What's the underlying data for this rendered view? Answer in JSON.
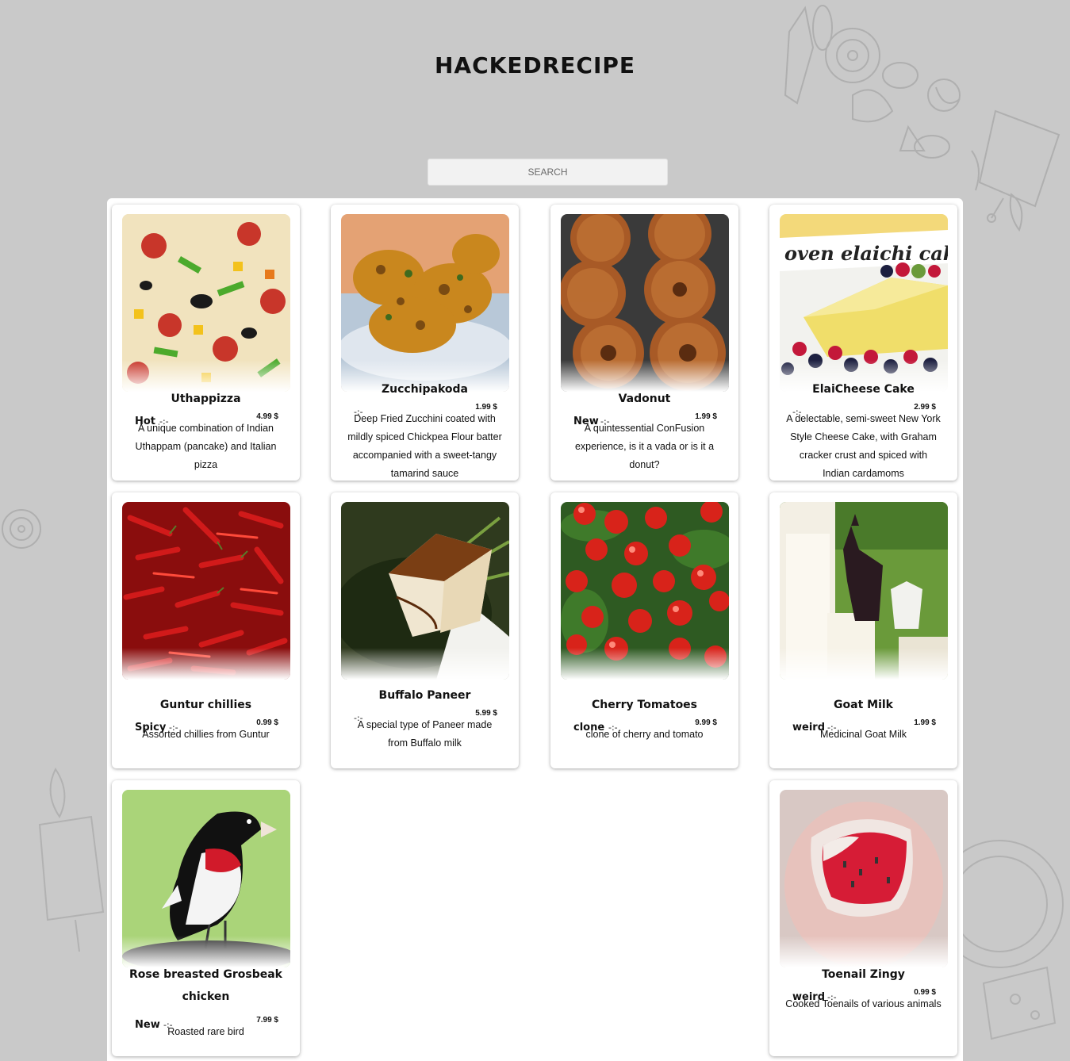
{
  "site": {
    "title": "HACKEDRECIPE",
    "search_placeholder": "SEARCH"
  },
  "colors": {
    "background": "#c9c9c9",
    "panel": "#ffffff",
    "card_text": "#111111"
  },
  "dishes": [
    {
      "name": "Uthappizza",
      "label": "Hot",
      "separator": "-:-",
      "price": "4.99 $",
      "description": "A unique combination of Indian Uthappam (pancake) and Italian pizza",
      "image": "pizza-image"
    },
    {
      "name": "Zucchipakoda",
      "label": "",
      "separator": "-:-",
      "price": "1.99 $",
      "description": "Deep Fried Zucchini coated with mildly spiced Chickpea Flour batter accompanied with a sweet-tangy tamarind sauce",
      "image": "pakoda-image"
    },
    {
      "name": "Vadonut",
      "label": "New",
      "separator": "-:-",
      "price": "1.99 $",
      "description": "A quintessential ConFusion experience, is it a vada or is it a donut?",
      "image": "donut-image"
    },
    {
      "name": "ElaiCheese Cake",
      "label": "",
      "separator": "-:-",
      "price": "2.99 $",
      "description": "A delectable, semi-sweet New York Style Cheese Cake, with Graham cracker crust and spiced with Indian cardamoms",
      "image": "cheesecake-image"
    },
    {
      "name": "Guntur chillies",
      "label": "Spicy",
      "separator": "-:-",
      "price": "0.99 $",
      "description": "Assorted chillies from Guntur",
      "image": "chillies-image"
    },
    {
      "name": "Buffalo Paneer",
      "label": "",
      "separator": "-:-",
      "price": "5.99 $",
      "description": "A special type of Paneer made from Buffalo milk",
      "image": "paneer-image"
    },
    {
      "name": "Cherry Tomatoes",
      "label": "clone",
      "separator": "-:-",
      "price": "9.99 $",
      "description": "clone of cherry and tomato",
      "image": "tomatoes-image"
    },
    {
      "name": "Goat Milk",
      "label": "weird",
      "separator": "-:-",
      "price": "1.99 $",
      "description": "Medicinal Goat Milk",
      "image": "goat-milk-image"
    },
    {
      "name": "Rose breasted Grosbeak chicken",
      "label": "New",
      "separator": "-:-",
      "price": "7.99 $",
      "description": "Roasted rare bird",
      "image": "bird-image"
    },
    {
      "name": "Toenail Zingy",
      "label": "weird",
      "separator": "-:-",
      "price": "0.99 $",
      "description": "Cooked Toenails of various animals",
      "image": "toenail-image"
    }
  ],
  "image_text": {
    "cake_banner": "oven elaichi cake"
  }
}
